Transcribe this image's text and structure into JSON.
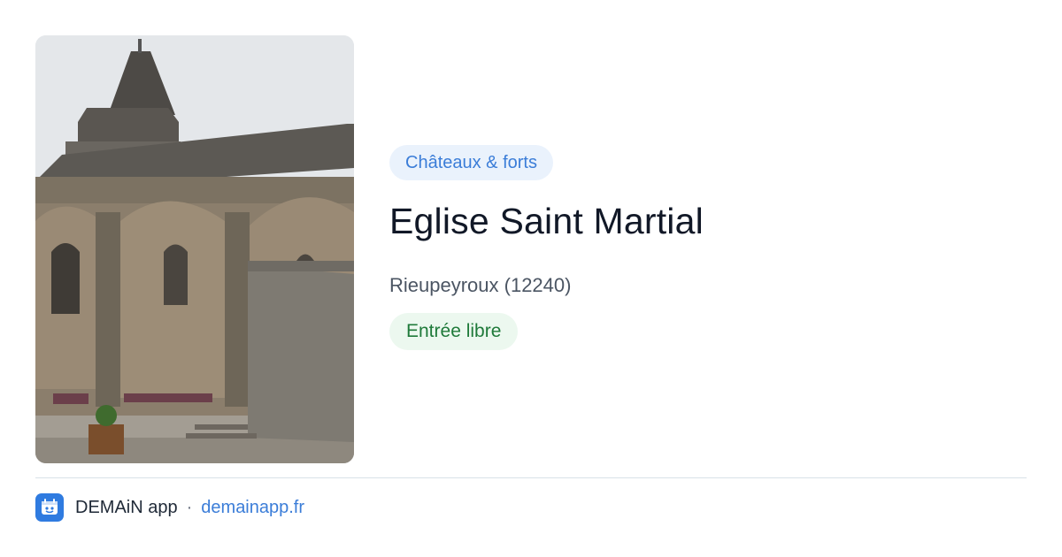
{
  "card": {
    "category": "Châteaux & forts",
    "title": "Eglise Saint Martial",
    "location": "Rieupeyroux (12240)",
    "access": "Entrée libre",
    "image_subject": "stone church exterior photo"
  },
  "footer": {
    "app_name": "DEMAiN app",
    "separator": "·",
    "link": "demainapp.fr",
    "icon": "demain-app-icon"
  },
  "colors": {
    "category_bg": "#eaf2fc",
    "category_text": "#3b7dd8",
    "access_bg": "#ecf8ef",
    "access_text": "#1f7a3a",
    "app_icon": "#2f7be0"
  }
}
